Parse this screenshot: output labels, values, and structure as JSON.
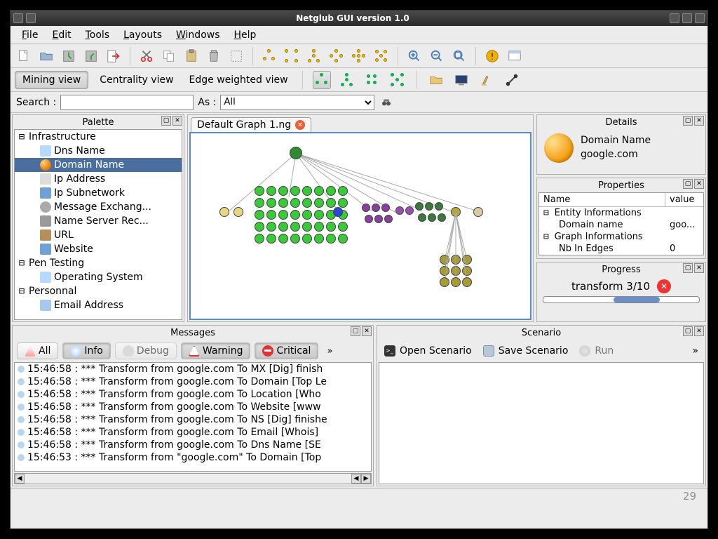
{
  "window": {
    "title": "Netglub GUI version 1.0"
  },
  "menus": {
    "file_html": "<u>F</u>ile",
    "edit_html": "<u>E</u>dit",
    "tools_html": "<u>T</u>ools",
    "layouts_html": "<u>L</u>ayouts",
    "windows_html": "<u>W</u>indows",
    "help_html": "<u>H</u>elp"
  },
  "views": {
    "mining": "Mining view",
    "centrality": "Centrality view",
    "edge": "Edge weighted view"
  },
  "search": {
    "label": "Search :",
    "value": "",
    "as_label": "As :",
    "as_value": "All"
  },
  "palette": {
    "title": "Palette",
    "categories": [
      {
        "name": "Infrastructure",
        "expanded": true,
        "items": [
          {
            "label": "Dns Name",
            "icon": "ti-screen"
          },
          {
            "label": "Domain Name",
            "icon": "ti-globe",
            "selected": true
          },
          {
            "label": "Ip Address",
            "icon": "ti-text"
          },
          {
            "label": "Ip Subnetwork",
            "icon": "ti-folder"
          },
          {
            "label": "Message Exchang...",
            "icon": "ti-clip"
          },
          {
            "label": "Name Server Rec...",
            "icon": "ti-server"
          },
          {
            "label": "URL",
            "icon": "ti-link"
          },
          {
            "label": "Website",
            "icon": "ti-folder"
          }
        ]
      },
      {
        "name": "Pen Testing",
        "expanded": true,
        "items": [
          {
            "label": "Operating System",
            "icon": "ti-screen"
          }
        ]
      },
      {
        "name": "Personnal",
        "expanded": true,
        "items": [
          {
            "label": "Email Address",
            "icon": "ti-mail"
          }
        ]
      }
    ]
  },
  "graph": {
    "tab_label": "Default Graph 1.ng"
  },
  "details": {
    "title": "Details",
    "type": "Domain Name",
    "value": "google.com"
  },
  "properties": {
    "title": "Properties",
    "headers": {
      "name": "Name",
      "value": "value"
    },
    "groups": [
      {
        "group": "Entity Informations",
        "rows": [
          {
            "name": "Domain name",
            "value": "goo..."
          }
        ]
      },
      {
        "group": "Graph Informations",
        "rows": [
          {
            "name": "Nb In Edges",
            "value": "0"
          }
        ]
      }
    ]
  },
  "progress": {
    "title": "Progress",
    "text": "transform 3/10"
  },
  "messages": {
    "title": "Messages",
    "filters": {
      "all": "All",
      "info": "Info",
      "debug": "Debug",
      "warning": "Warning",
      "critical": "Critical"
    },
    "rows": [
      "15:46:58 : *** Transform from google.com To MX [Dig] finish",
      "15:46:58 : *** Transform from google.com To Domain [Top Le",
      "15:46:58 : *** Transform from google.com To Location [Who",
      "15:46:58 : *** Transform from google.com To Website [www",
      "15:46:58 : *** Transform from google.com To NS [Dig] finishe",
      "15:46:58 : *** Transform from google.com To Email [Whois]",
      "15:46:58 : *** Transform from google.com To Dns Name [SE",
      "15:46:53 : *** Transform from \"google.com\" To Domain [Top"
    ]
  },
  "scenario": {
    "title": "Scenario",
    "open": "Open Scenario",
    "save": "Save Scenario",
    "run": "Run"
  },
  "statusbar": {
    "value": "29"
  },
  "chart_data": {
    "type": "network-graph",
    "root": {
      "label": "google.com",
      "color": "#2e8b2e"
    },
    "clusters": [
      {
        "color": "#e8d682",
        "count": 2,
        "label_hint": "MX/NS records"
      },
      {
        "color": "#39c939",
        "count": 40,
        "label_hint": "DNS / subdomain nodes (8x5 grid)"
      },
      {
        "color": "#2a4ad6",
        "count": 1,
        "label_hint": "single blue node"
      },
      {
        "color": "#8a3fa0",
        "count": 6,
        "label_hint": "purple cluster"
      },
      {
        "color": "#9a4fb0",
        "count": 2,
        "label_hint": "purple pair"
      },
      {
        "color": "#3a7a3a",
        "count": 6,
        "label_hint": "dark-green cluster"
      },
      {
        "color": "#b6a63e",
        "count": 1,
        "label_hint": "olive single with children"
      },
      {
        "color": "#d9cba0",
        "count": 1,
        "label_hint": "tan single"
      },
      {
        "color": "#a79a38",
        "count": 9,
        "label_hint": "olive 3x3 subcluster under olive single"
      }
    ]
  }
}
